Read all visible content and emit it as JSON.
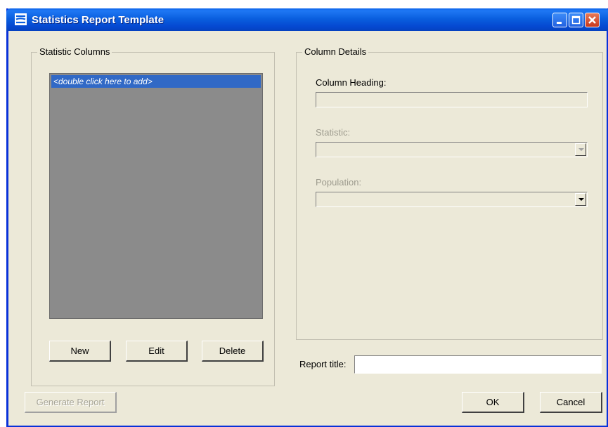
{
  "window": {
    "title": "Statistics Report Template",
    "icons": {
      "app": "statistics-app-icon",
      "minimize": "minimize-icon",
      "maximize": "maximize-icon",
      "close": "close-icon"
    }
  },
  "columns_group": {
    "legend": "Statistic Columns",
    "list_items": [
      "<double click here to add>"
    ],
    "buttons": {
      "new": "New",
      "edit": "Edit",
      "delete": "Delete"
    }
  },
  "details_group": {
    "legend": "Column Details",
    "column_heading": {
      "label": "Column Heading:",
      "value": ""
    },
    "statistic": {
      "label": "Statistic:",
      "value": ""
    },
    "population": {
      "label": "Population:",
      "value": ""
    }
  },
  "report_title": {
    "label": "Report title:",
    "value": ""
  },
  "footer": {
    "generate_report": "Generate Report",
    "ok": "OK",
    "cancel": "Cancel"
  },
  "colors": {
    "title_bar": "#0a5fdf",
    "selection": "#3169c6",
    "list_background": "#8b8b8b",
    "dialog_face": "#ece9d8"
  }
}
